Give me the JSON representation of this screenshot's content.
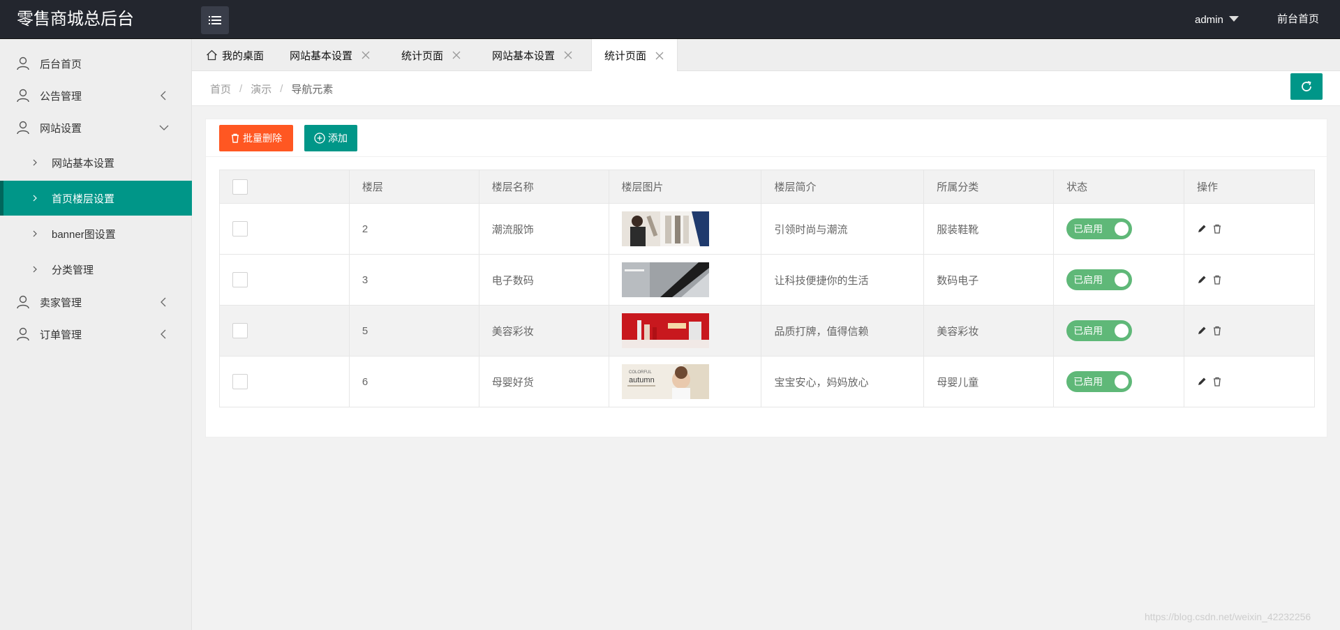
{
  "header": {
    "logo": "零售商城总后台",
    "user": "admin",
    "home_link": "前台首页"
  },
  "sidebar": {
    "items": [
      {
        "label": "后台首页"
      },
      {
        "label": "公告管理"
      },
      {
        "label": "网站设置"
      },
      {
        "label": "卖家管理"
      },
      {
        "label": "订单管理"
      }
    ],
    "sub_items": [
      {
        "label": "网站基本设置"
      },
      {
        "label": "首页楼层设置"
      },
      {
        "label": "banner图设置"
      },
      {
        "label": "分类管理"
      }
    ]
  },
  "tabs": [
    {
      "label": "我的桌面"
    },
    {
      "label": "网站基本设置"
    },
    {
      "label": "统计页面"
    },
    {
      "label": "网站基本设置"
    },
    {
      "label": "统计页面"
    }
  ],
  "breadcrumb": [
    "首页",
    "演示",
    "导航元素"
  ],
  "toolbar": {
    "batch_delete": "批量删除",
    "add": "添加"
  },
  "table": {
    "headers": [
      "楼层",
      "楼层名称",
      "楼层图片",
      "楼层简介",
      "所属分类",
      "状态",
      "操作"
    ],
    "rows": [
      {
        "floor": "2",
        "name": "潮流服饰",
        "desc": "引领时尚与潮流",
        "category": "服装鞋靴",
        "status": "已启用"
      },
      {
        "floor": "3",
        "name": "电子数码",
        "desc": "让科技便捷你的生活",
        "category": "数码电子",
        "status": "已启用"
      },
      {
        "floor": "5",
        "name": "美容彩妆",
        "desc": "品质打牌，值得信赖",
        "category": "美容彩妆",
        "status": "已启用"
      },
      {
        "floor": "6",
        "name": "母婴好货",
        "desc": "宝宝安心，妈妈放心",
        "category": "母婴儿童",
        "status": "已启用"
      }
    ],
    "thumb_texts": [
      "autumn"
    ]
  },
  "watermark": "https://blog.csdn.net/weixin_42232256",
  "colors": {
    "header_bg": "#23262e",
    "accent": "#009688",
    "danger": "#ff5722",
    "switch_on": "#5fb878"
  }
}
